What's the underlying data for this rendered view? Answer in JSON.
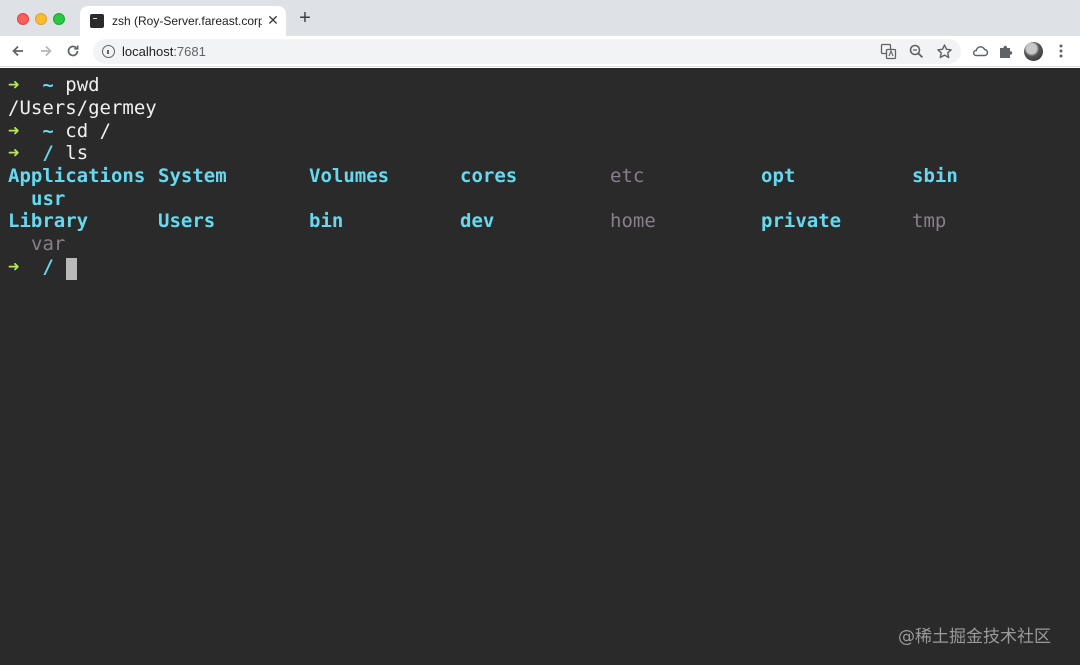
{
  "browser": {
    "tab": {
      "title": "zsh (Roy-Server.fareast.corp.m",
      "close_glyph": "✕"
    },
    "new_tab_glyph": "+",
    "url": {
      "host": "localhost",
      "port": ":7681"
    },
    "icons": {
      "back": "arrow-left-icon",
      "forward": "arrow-right-icon",
      "reload": "reload-icon",
      "info": "info-icon",
      "translate": "translate-icon",
      "zoom": "zoom-icon",
      "star": "star-icon",
      "profile": "profile-icon",
      "extensions": "extensions-icon",
      "menu": "menu-icon"
    }
  },
  "terminal": {
    "colors": {
      "background": "#2a2a2b",
      "arrow": "#b5e853",
      "dir": "#66d9ef",
      "symlink": "#887f8b",
      "text": "#f0f0f0"
    },
    "lines": [
      {
        "arrow": "➜",
        "dir": "~",
        "cmd": "pwd"
      },
      {
        "output": "/Users/germey"
      },
      {
        "arrow": "➜",
        "dir": "~",
        "cmd": "cd /"
      },
      {
        "arrow": "➜",
        "dir": "/",
        "cmd": "ls"
      }
    ],
    "ls_entries": [
      {
        "name": "Applications",
        "kind": "dir"
      },
      {
        "name": "System",
        "kind": "dir"
      },
      {
        "name": "Volumes",
        "kind": "dir"
      },
      {
        "name": "cores",
        "kind": "dir"
      },
      {
        "name": "etc",
        "kind": "link"
      },
      {
        "name": "opt",
        "kind": "dir"
      },
      {
        "name": "sbin",
        "kind": "dir"
      },
      {
        "name": "usr",
        "kind": "dir"
      },
      {
        "name": "Library",
        "kind": "dir"
      },
      {
        "name": "Users",
        "kind": "dir"
      },
      {
        "name": "bin",
        "kind": "dir"
      },
      {
        "name": "dev",
        "kind": "dir"
      },
      {
        "name": "home",
        "kind": "link"
      },
      {
        "name": "private",
        "kind": "dir"
      },
      {
        "name": "tmp",
        "kind": "link"
      },
      {
        "name": "var",
        "kind": "link"
      }
    ],
    "prompt": {
      "arrow": "➜",
      "dir": "/"
    }
  },
  "watermark": "@稀土掘金技术社区"
}
